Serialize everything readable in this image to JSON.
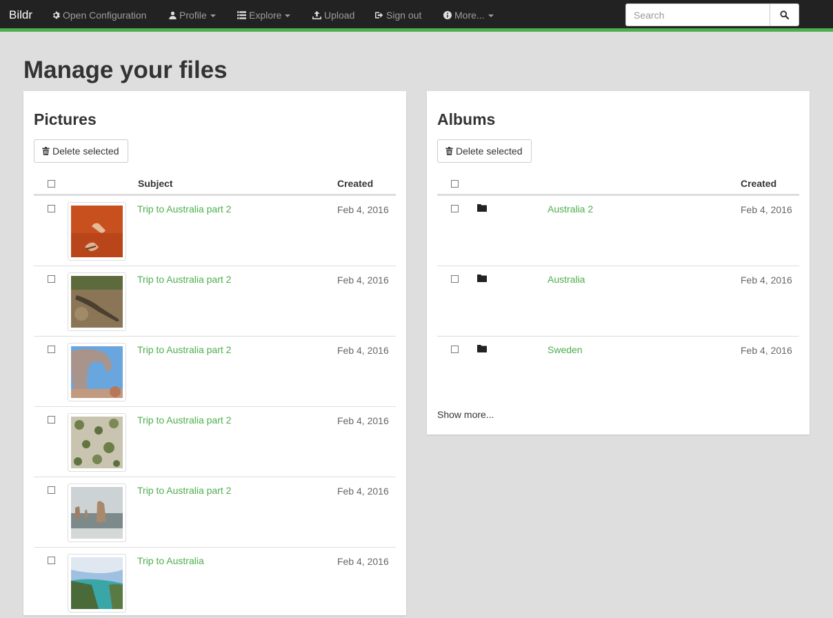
{
  "app": {
    "brand": "Bildr"
  },
  "nav": {
    "open_configuration": "Open Configuration",
    "profile": "Profile",
    "explore": "Explore",
    "upload": "Upload",
    "sign_out": "Sign out",
    "more": "More..."
  },
  "search": {
    "placeholder": "Search"
  },
  "page": {
    "title": "Manage your files"
  },
  "pictures": {
    "title": "Pictures",
    "delete_label": "Delete selected",
    "columns": {
      "subject": "Subject",
      "created": "Created"
    },
    "rows": [
      {
        "subject": "Trip to Australia part 2",
        "created": "Feb 4, 2016",
        "thumb": "feet-on-red-sand"
      },
      {
        "subject": "Trip to Australia part 2",
        "created": "Feb 4, 2016",
        "thumb": "lizard"
      },
      {
        "subject": "Trip to Australia part 2",
        "created": "Feb 4, 2016",
        "thumb": "rock-arch"
      },
      {
        "subject": "Trip to Australia part 2",
        "created": "Feb 4, 2016",
        "thumb": "scrub-bushes"
      },
      {
        "subject": "Trip to Australia part 2",
        "created": "Feb 4, 2016",
        "thumb": "sea-stacks"
      },
      {
        "subject": "Trip to Australia",
        "created": "Feb 4, 2016",
        "thumb": "coastline"
      }
    ]
  },
  "albums": {
    "title": "Albums",
    "delete_label": "Delete selected",
    "columns": {
      "created": "Created"
    },
    "rows": [
      {
        "name": "Australia 2",
        "created": "Feb 4, 2016"
      },
      {
        "name": "Australia",
        "created": "Feb 4, 2016"
      },
      {
        "name": "Sweden",
        "created": "Feb 4, 2016"
      }
    ],
    "show_more": "Show more..."
  },
  "colors": {
    "accent": "#4cae4c",
    "navbar": "#222222",
    "background": "#dedede"
  }
}
